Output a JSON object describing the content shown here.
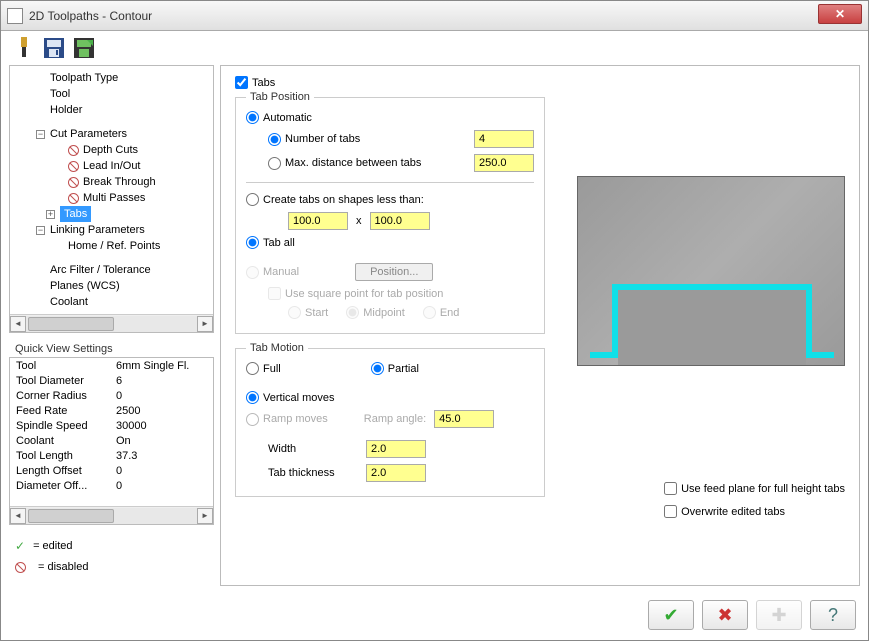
{
  "window": {
    "title": "2D Toolpaths - Contour"
  },
  "tree": {
    "items": [
      "Toolpath Type",
      "Tool",
      "Holder",
      "Cut Parameters",
      "Depth Cuts",
      "Lead In/Out",
      "Break Through",
      "Multi Passes",
      "Tabs",
      "Linking Parameters",
      "Home / Ref. Points",
      "Arc Filter / Tolerance",
      "Planes (WCS)",
      "Coolant"
    ]
  },
  "quickview": {
    "title": "Quick View Settings",
    "rows": [
      {
        "label": "Tool",
        "value": "6mm Single Fl."
      },
      {
        "label": "Tool Diameter",
        "value": "6"
      },
      {
        "label": "Corner Radius",
        "value": "0"
      },
      {
        "label": "Feed Rate",
        "value": "2500"
      },
      {
        "label": "Spindle Speed",
        "value": "30000"
      },
      {
        "label": "Coolant",
        "value": "On"
      },
      {
        "label": "Tool Length",
        "value": "37.3"
      },
      {
        "label": "Length Offset",
        "value": "0"
      },
      {
        "label": "Diameter Off...",
        "value": "0"
      }
    ]
  },
  "legend": {
    "edited": "= edited",
    "disabled": "= disabled"
  },
  "tabs": {
    "checkbox": "Tabs",
    "tabPosition": {
      "title": "Tab Position",
      "automatic": "Automatic",
      "numberOfTabs": {
        "label": "Number of tabs",
        "value": "4"
      },
      "maxDistance": {
        "label": "Max. distance between tabs",
        "value": "250.0"
      },
      "createSmaller": {
        "label": "Create tabs on shapes less than:",
        "x": "100.0",
        "xLabel": "x",
        "y": "100.0"
      },
      "tabAll": "Tab all",
      "manual": "Manual",
      "positionBtn": "Position...",
      "useSquare": "Use square point for tab position",
      "start": "Start",
      "midpoint": "Midpoint",
      "end": "End"
    },
    "tabMotion": {
      "title": "Tab Motion",
      "full": "Full",
      "partial": "Partial",
      "vertical": "Vertical moves",
      "ramp": {
        "label": "Ramp moves",
        "angleLabel": "Ramp angle:",
        "angleValue": "45.0"
      },
      "width": {
        "label": "Width",
        "value": "2.0"
      },
      "thickness": {
        "label": "Tab thickness",
        "value": "2.0"
      }
    },
    "useFeedPlane": "Use feed plane for full height tabs",
    "overwrite": "Overwrite edited tabs"
  }
}
